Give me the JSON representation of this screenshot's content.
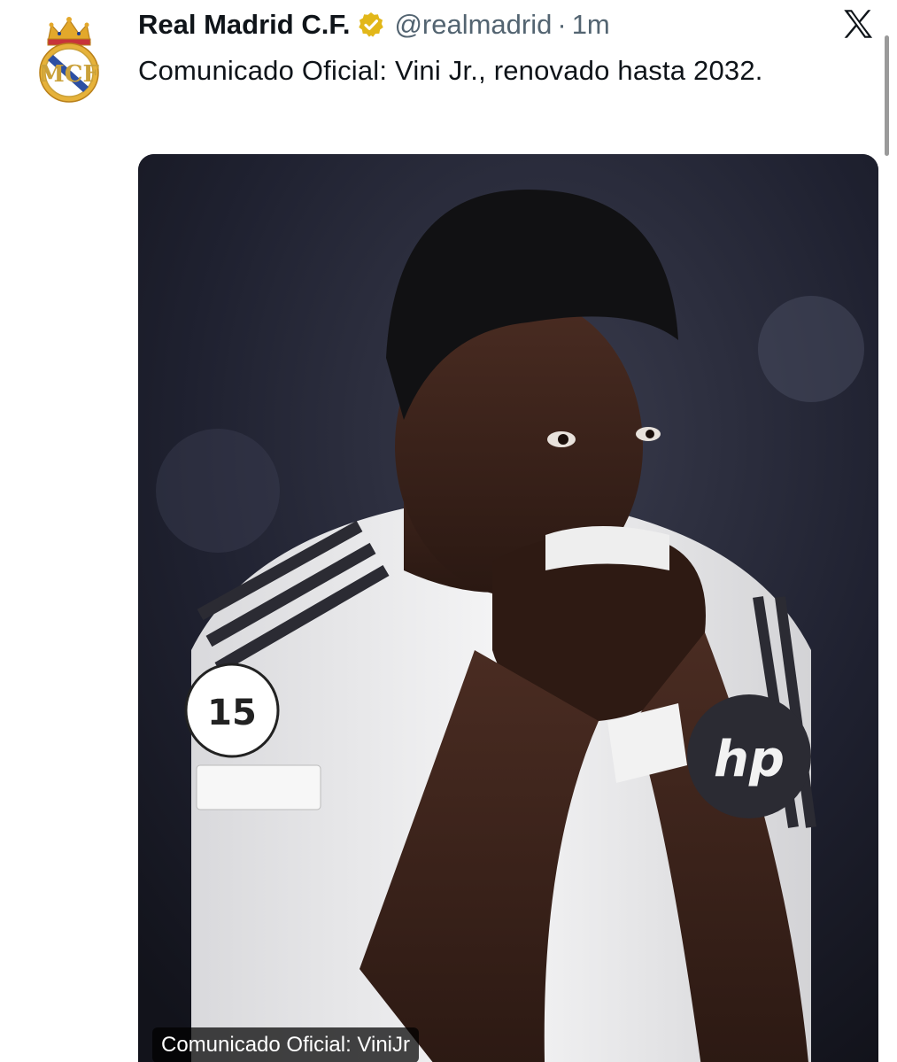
{
  "account": {
    "display_name": "Real Madrid C.F.",
    "handle": "@realmadrid",
    "separator": "·",
    "time": "1m",
    "verified_badge_color": "#e2b719",
    "avatar_icon": "real-madrid-crest-icon"
  },
  "platform": {
    "logo_icon": "x-logo-icon"
  },
  "tweet": {
    "text": "Comunicado Oficial: Vini Jr., renovado hasta 2032."
  },
  "media": {
    "alt_text_badge": "Comunicado Oficial: ViniJr",
    "image_subject": "photo-of-player-kissing-shirt"
  },
  "colors": {
    "text_primary": "#0f1419",
    "text_secondary": "#536471",
    "background": "#ffffff"
  }
}
